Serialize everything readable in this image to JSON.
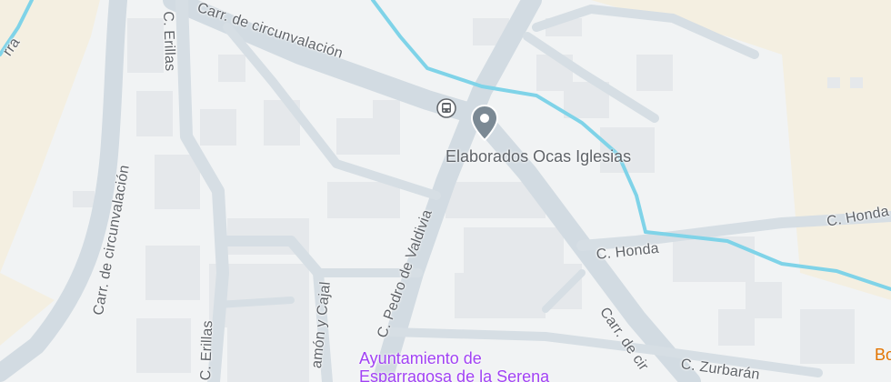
{
  "map": {
    "colors": {
      "land": "#f1f3f4",
      "rural": "#f4efe1",
      "road": "#d3dce3",
      "road_edge": "#c6d0d8",
      "building": "#e6e8eb",
      "water": "#7fd3e8",
      "poi_pin": "#7b8994",
      "civic": "#a142f4",
      "label": "#5f6368"
    },
    "streets": {
      "circunvalacion_top": "Carr. de circunvalación",
      "circunvalacion_left": "Carr. de circunvalación",
      "circunvalacion_bottom": "Carr. de cir",
      "erillas_top": "C. Erillas",
      "erillas_bottom": "C. Erillas",
      "pedro_valdivia": "C. Pedro de Valdivia",
      "honda_mid": "C. Honda",
      "honda_right": "C. Honda",
      "ramon_cajal": "amón y Cajal",
      "zurbaran": "C. Zurbarán",
      "top_left_fragment": "rra"
    },
    "poi": {
      "name": "Elaborados Ocas Iglesias",
      "icon": "place-pin-icon"
    },
    "transit": {
      "icon": "bus-stop-icon"
    },
    "civic": {
      "line1": "Ayuntamiento de",
      "line2": "Esparragosa de la Serena"
    },
    "edge_label": "Bo"
  }
}
